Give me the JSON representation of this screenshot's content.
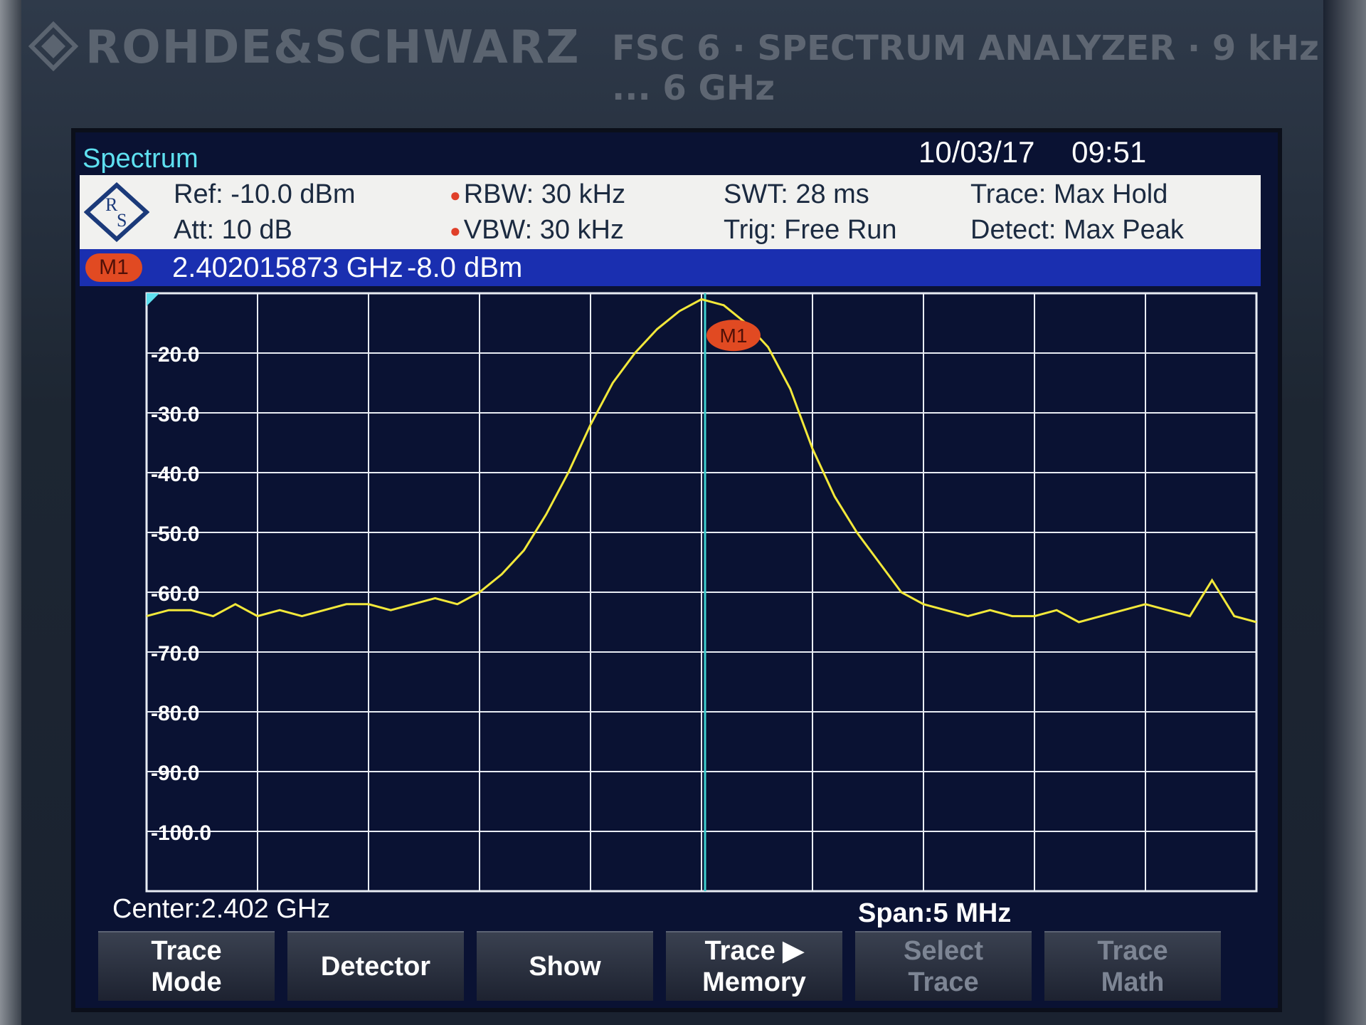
{
  "device": {
    "brand": "ROHDE&SCHWARZ",
    "model": "FSC 6 · SPECTRUM ANALYZER · 9 kHz ... 6 GHz"
  },
  "screen": {
    "mode_title": "Spectrum",
    "date": "10/03/17",
    "time": "09:51"
  },
  "settings": {
    "ref": "Ref:  -10.0 dBm",
    "att": "Att:  10 dB",
    "rbw": "RBW:   30 kHz",
    "vbw": "VBW:   30 kHz",
    "swt": "SWT:   28 ms",
    "trig": "Trig:   Free Run",
    "trace": "Trace:    Max Hold",
    "detect": "Detect:  Max Peak"
  },
  "marker": {
    "label": "M1",
    "frequency": "2.402015873  GHz",
    "level": "-8.0  dBm"
  },
  "footer": {
    "center": "Center:2.402 GHz",
    "span": "Span:5 MHz"
  },
  "softkeys": [
    {
      "label": "Trace\nMode",
      "dim": false
    },
    {
      "label": "Detector",
      "dim": false
    },
    {
      "label": "Show",
      "dim": false
    },
    {
      "label": "Trace ▶\nMemory",
      "dim": false
    },
    {
      "label": "Select\nTrace",
      "dim": true
    },
    {
      "label": "Trace\nMath",
      "dim": true
    }
  ],
  "colors": {
    "trace": "#f2e83a",
    "marker_line": "#3fd0d0",
    "grid": "#e8ecf3",
    "screen_bg": "#0a1233",
    "marker_badge": "#e14a22"
  },
  "chart_data": {
    "type": "line",
    "title": "",
    "xlabel": "",
    "ylabel": "",
    "xlim": [
      2399.5,
      2404.5
    ],
    "ylim": [
      -110,
      -10
    ],
    "x_unit": "MHz",
    "y_unit": "dBm",
    "yticks": [
      -20.0,
      -30.0,
      -40.0,
      -50.0,
      -60.0,
      -70.0,
      -80.0,
      -90.0,
      -100.0
    ],
    "ytick_labels": [
      "-20.0",
      "-30.0",
      "-40.0",
      "-50.0",
      "-60.0",
      "-70.0",
      "-80.0",
      "-90.0",
      "-100.0"
    ],
    "grid": true,
    "marker": {
      "name": "M1",
      "x": 2402.016,
      "y": -8.0
    },
    "series": [
      {
        "x": [
          2399.5,
          2399.6,
          2399.7,
          2399.8,
          2399.9,
          2400.0,
          2400.1,
          2400.2,
          2400.3,
          2400.4,
          2400.5,
          2400.6,
          2400.7,
          2400.8,
          2400.9,
          2401.0,
          2401.1,
          2401.2,
          2401.3,
          2401.4,
          2401.5,
          2401.6,
          2401.7,
          2401.8,
          2401.9,
          2402.0,
          2402.1,
          2402.2,
          2402.3,
          2402.4,
          2402.5,
          2402.6,
          2402.7,
          2402.8,
          2402.9,
          2403.0,
          2403.1,
          2403.2,
          2403.3,
          2403.4,
          2403.5,
          2403.6,
          2403.7,
          2403.8,
          2403.9,
          2404.0,
          2404.1,
          2404.2,
          2404.3,
          2404.4,
          2404.5
        ],
        "values": [
          -64,
          -63,
          -63,
          -64,
          -62,
          -64,
          -63,
          -64,
          -63,
          -62,
          -62,
          -63,
          -62,
          -61,
          -62,
          -60,
          -57,
          -53,
          -47,
          -40,
          -32,
          -25,
          -20,
          -16,
          -13,
          -11,
          -12,
          -15,
          -19,
          -26,
          -36,
          -44,
          -50,
          -55,
          -60,
          -62,
          -63,
          -64,
          -63,
          -64,
          -64,
          -63,
          -65,
          -64,
          -63,
          -62,
          -63,
          -64,
          -58,
          -64,
          -65
        ]
      }
    ]
  }
}
